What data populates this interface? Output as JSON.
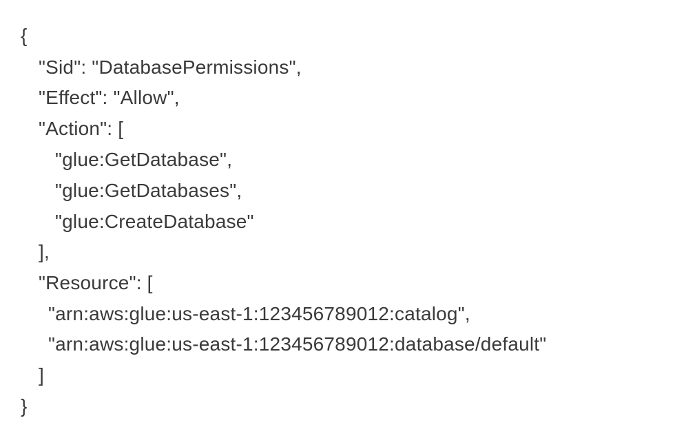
{
  "policy": {
    "open_brace": "{",
    "sid_line": "\"Sid\": \"DatabasePermissions\",",
    "effect_line": "\"Effect\": \"Allow\",",
    "action_open": "\"Action\": [",
    "actions": [
      "\"glue:GetDatabase\",",
      "\"glue:GetDatabases\",",
      "\"glue:CreateDatabase\""
    ],
    "action_close": "],",
    "resource_open": "\"Resource\": [",
    "resources": [
      "\"arn:aws:glue:us-east-1:123456789012:catalog\",",
      "\"arn:aws:glue:us-east-1:123456789012:database/default\""
    ],
    "resource_close": "]",
    "close_brace": "}"
  }
}
